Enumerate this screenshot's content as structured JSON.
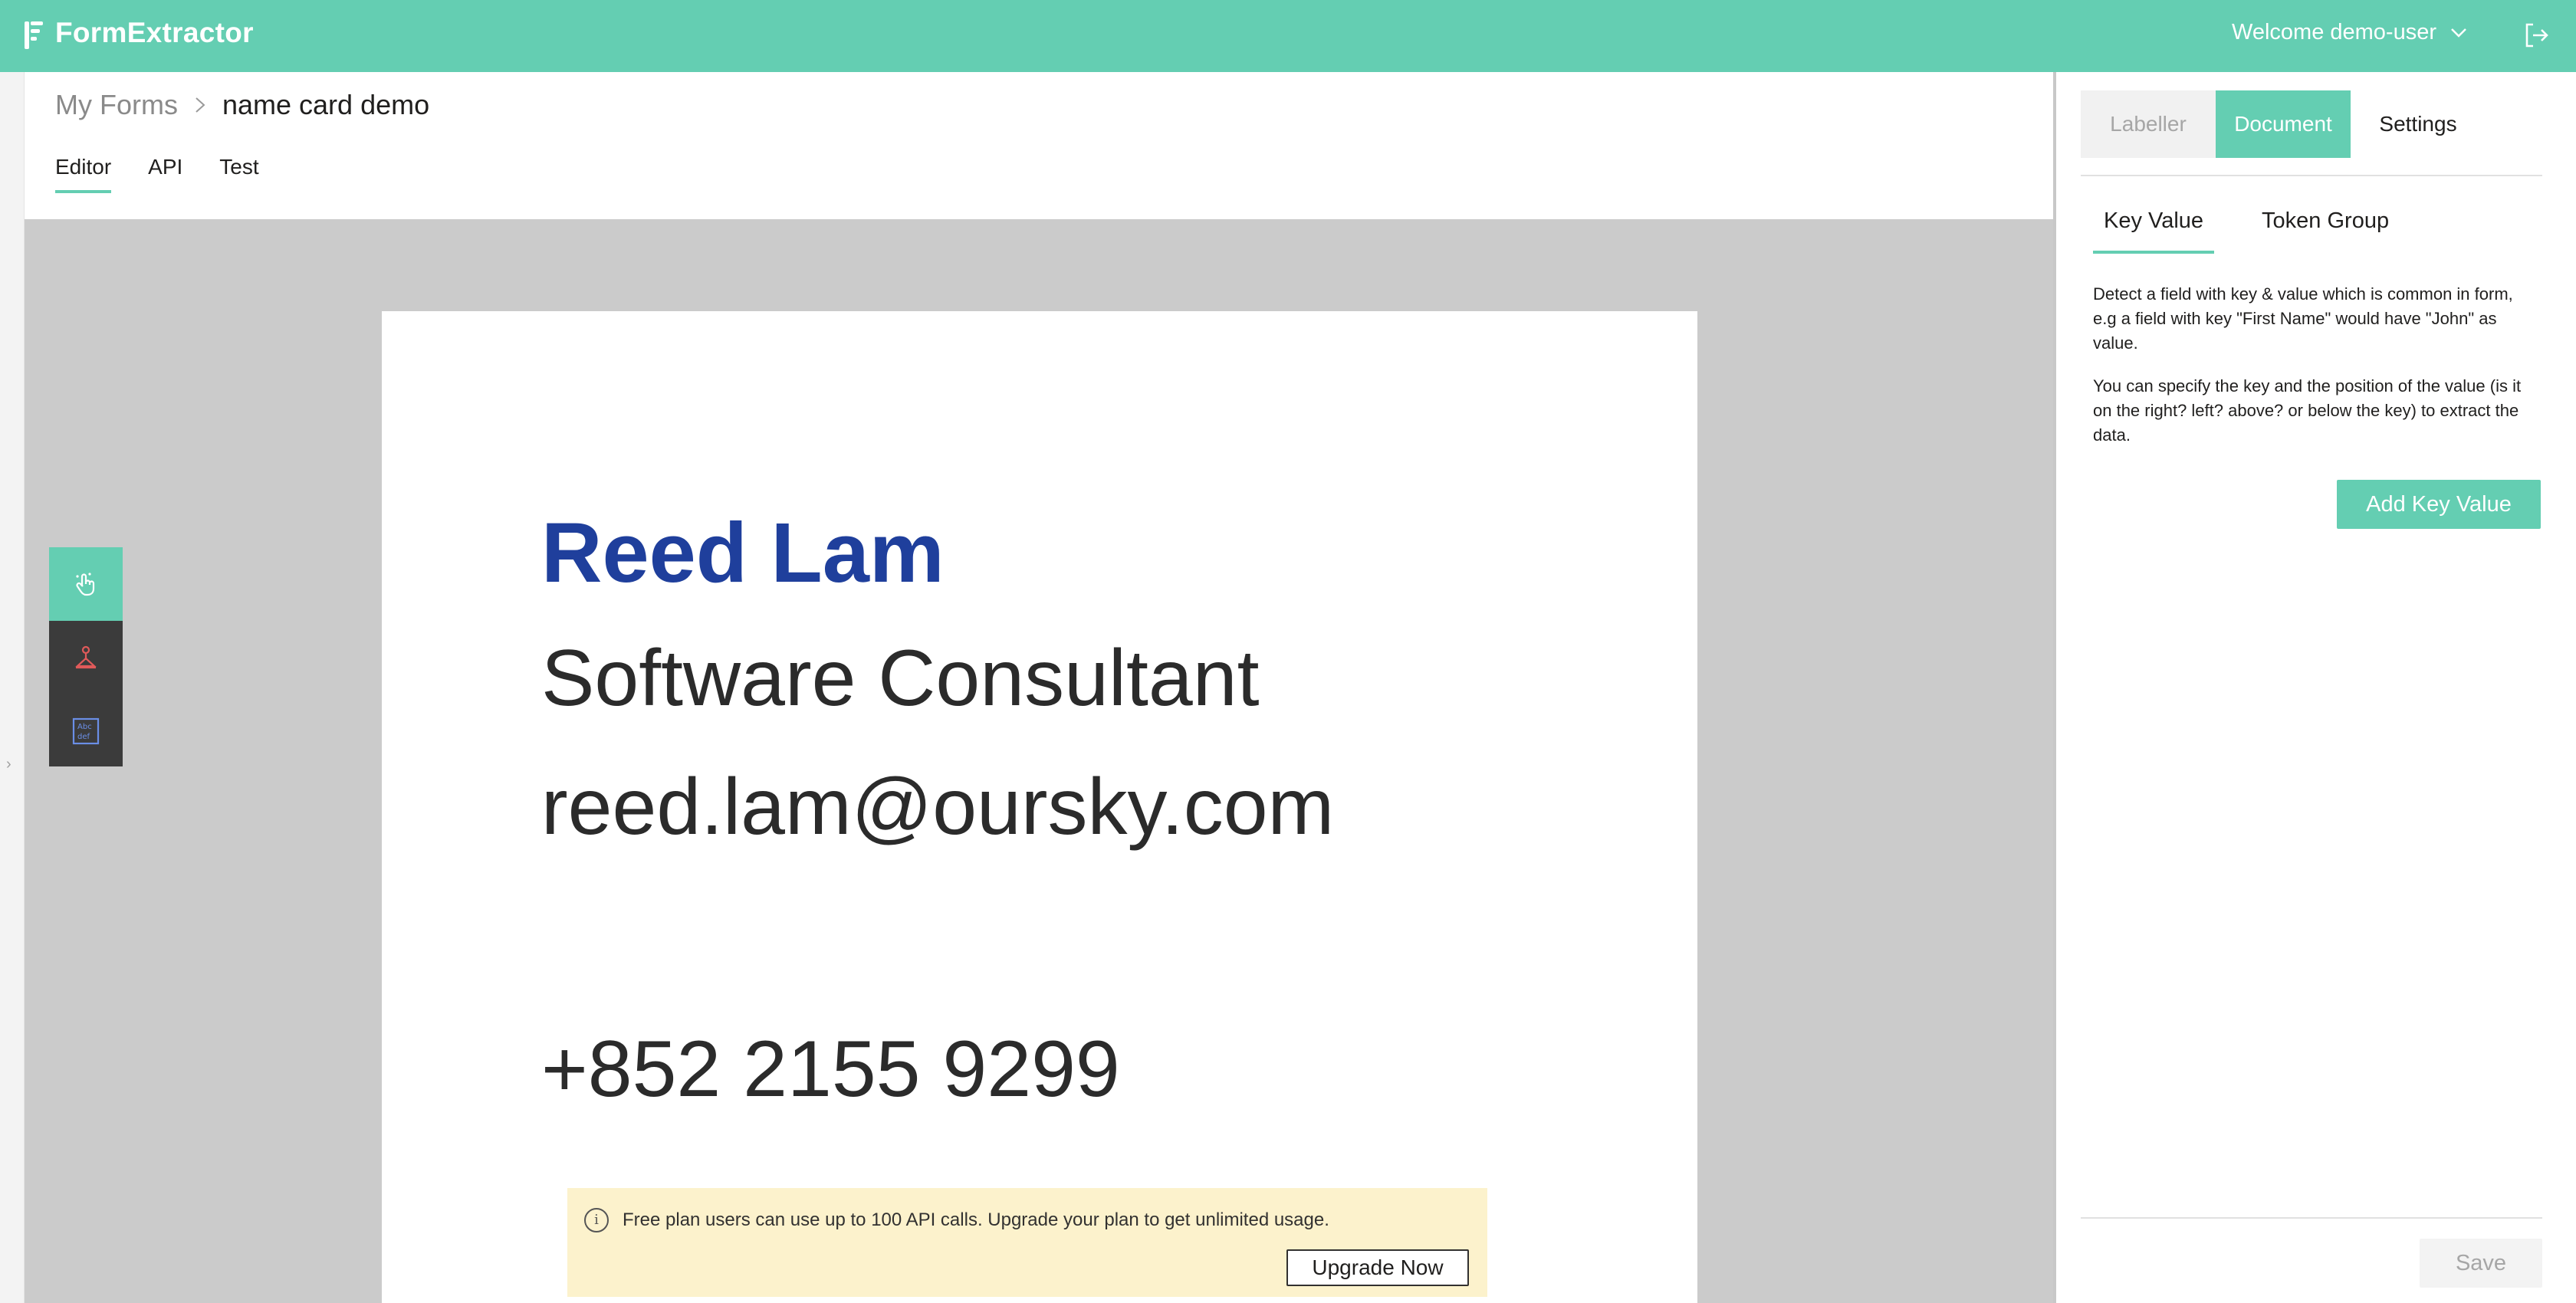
{
  "app": {
    "brand": "FormExtractor",
    "welcome": "Welcome demo-user",
    "icons": {
      "logo": "form-logo-icon",
      "chevron": "chevron-down-icon",
      "logout": "logout-icon"
    },
    "accent_color": "#64ceb2"
  },
  "breadcrumb": {
    "parent": "My Forms",
    "current": "name card demo"
  },
  "tabs": [
    {
      "label": "Editor",
      "active": true
    },
    {
      "label": "API",
      "active": false
    },
    {
      "label": "Test",
      "active": false
    }
  ],
  "card": {
    "name": "Reed Lam",
    "title": "Software Consultant",
    "email": "reed.lam@oursky.com",
    "phone": "+852 2155 9299",
    "name_color": "#1f3f9c"
  },
  "tools": [
    {
      "icon": "hand-pointer-icon",
      "active": true
    },
    {
      "icon": "anchor-key-icon",
      "active": false
    },
    {
      "icon": "text-token-icon",
      "active": false
    }
  ],
  "notice": {
    "text": "Free plan users can use up to 100 API calls. Upgrade your plan to get unlimited usage.",
    "button": "Upgrade Now",
    "background": "#fcf2cc"
  },
  "panel": {
    "tabs": [
      {
        "label": "Labeller",
        "state": "disabled"
      },
      {
        "label": "Document",
        "state": "active"
      },
      {
        "label": "Settings",
        "state": "normal"
      }
    ],
    "subtabs": [
      {
        "label": "Key Value",
        "active": true
      },
      {
        "label": "Token Group",
        "active": false
      }
    ],
    "description_1": "Detect a field with key & value which is common in form, e.g a field with key \"First Name\" would have \"John\" as value.",
    "description_2": "You can specify the key and the position of the value (is it on the right? left? above? or below the key) to extract the data.",
    "add_button": "Add Key Value",
    "save_button": "Save"
  }
}
